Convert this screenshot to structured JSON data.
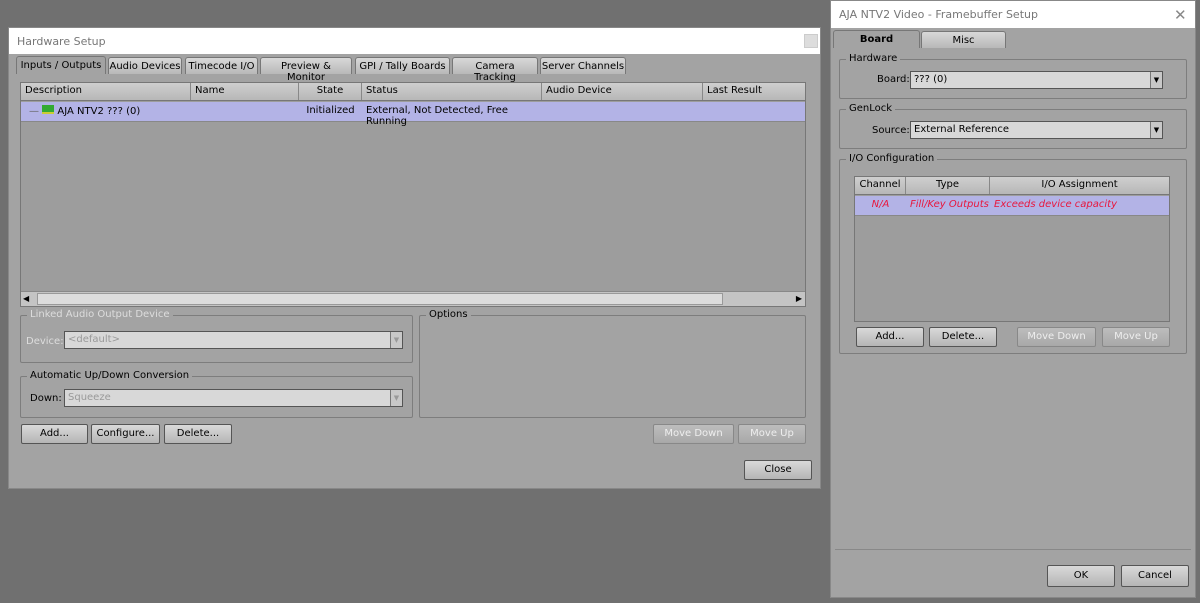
{
  "hardware_setup": {
    "title": "Hardware Setup",
    "tabs": [
      "Inputs / Outputs",
      "Audio Devices",
      "Timecode I/O",
      "Preview & Monitor",
      "GPI / Tally Boards",
      "Camera Tracking",
      "Server Channels"
    ],
    "columns": [
      "Description",
      "Name",
      "State",
      "Status",
      "Audio Device",
      "Last Result"
    ],
    "rows": [
      {
        "description": "AJA NTV2 ??? (0)",
        "name": "",
        "state": "Initialized",
        "status": "External, Not Detected, Free Running",
        "audio_device": "",
        "last_result": ""
      }
    ],
    "linked_audio": {
      "legend": "Linked Audio Output Device",
      "label": "Device:",
      "value": "<default>"
    },
    "conversion": {
      "legend": "Automatic Up/Down Conversion",
      "label": "Down:",
      "value": "Squeeze"
    },
    "options_legend": "Options",
    "buttons": {
      "add": "Add...",
      "configure": "Configure...",
      "delete": "Delete...",
      "move_down": "Move Down",
      "move_up": "Move Up",
      "close": "Close"
    }
  },
  "framebuffer": {
    "title": "AJA NTV2 Video - Framebuffer Setup",
    "tabs": [
      "Board",
      "Misc"
    ],
    "hardware": {
      "legend": "Hardware",
      "label": "Board:",
      "value": "??? (0)"
    },
    "genlock": {
      "legend": "GenLock",
      "label": "Source:",
      "value": "External Reference"
    },
    "io": {
      "legend": "I/O Configuration",
      "columns": [
        "Channel",
        "Type",
        "I/O Assignment"
      ],
      "rows": [
        {
          "channel": "N/A",
          "type": "Fill/Key Outputs",
          "assignment": "Exceeds device capacity"
        }
      ]
    },
    "buttons": {
      "add": "Add...",
      "delete": "Delete...",
      "move_down": "Move Down",
      "move_up": "Move Up",
      "ok": "OK",
      "cancel": "Cancel"
    }
  },
  "colors": {
    "selected_row": "#b3b3e6",
    "error_text": "#e8163c"
  }
}
